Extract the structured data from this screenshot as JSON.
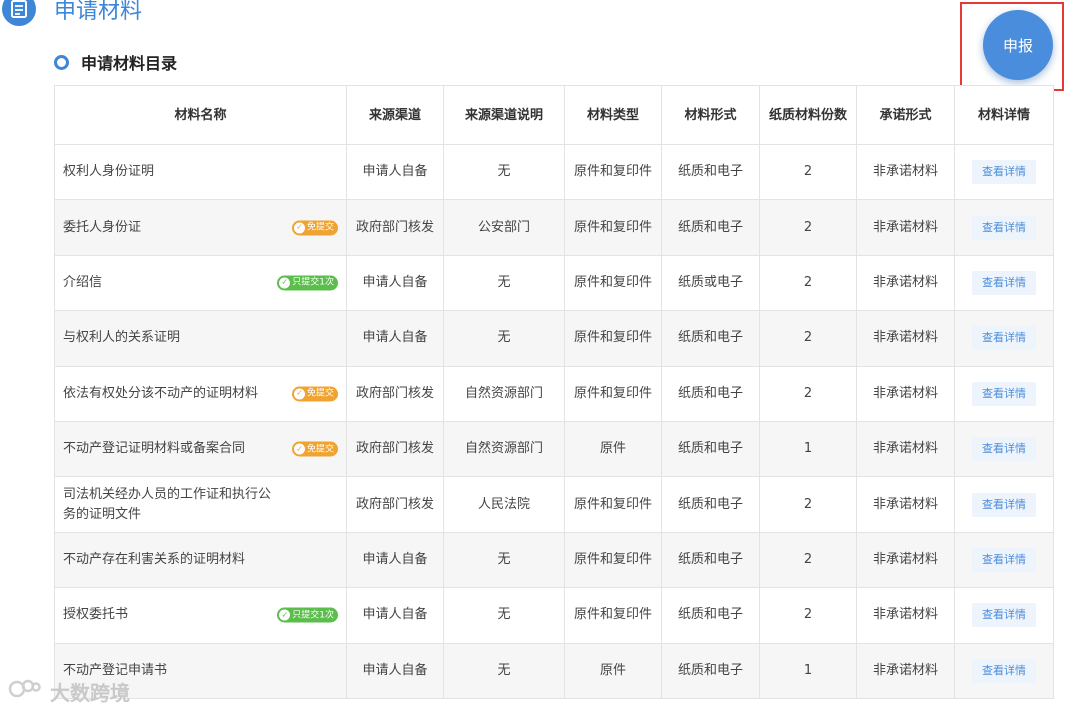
{
  "header": {
    "title": "申请材料",
    "icon": "document-icon"
  },
  "subsection": {
    "title": "申请材料目录",
    "icon": "ring-icon"
  },
  "apply_button": {
    "label": "申报"
  },
  "table": {
    "columns": [
      "材料名称",
      "来源渠道",
      "来源渠道说明",
      "材料类型",
      "材料形式",
      "纸质材料份数",
      "承诺形式",
      "材料详情"
    ],
    "rows": [
      {
        "name": "权利人身份证明",
        "tag": "",
        "tag_color": "",
        "source": "申请人自备",
        "source_note": "无",
        "type": "原件和复印件",
        "form": "纸质和电子",
        "copies": "2",
        "promise": "非承诺材料",
        "detail": "查看详情"
      },
      {
        "name": "委托人身份证",
        "tag": "免提交",
        "tag_color": "orange",
        "source": "政府部门核发",
        "source_note": "公安部门",
        "type": "原件和复印件",
        "form": "纸质和电子",
        "copies": "2",
        "promise": "非承诺材料",
        "detail": "查看详情"
      },
      {
        "name": "介绍信",
        "tag": "只提交1次",
        "tag_color": "green",
        "source": "申请人自备",
        "source_note": "无",
        "type": "原件和复印件",
        "form": "纸质或电子",
        "copies": "2",
        "promise": "非承诺材料",
        "detail": "查看详情"
      },
      {
        "name": "与权利人的关系证明",
        "tag": "",
        "tag_color": "",
        "source": "申请人自备",
        "source_note": "无",
        "type": "原件和复印件",
        "form": "纸质和电子",
        "copies": "2",
        "promise": "非承诺材料",
        "detail": "查看详情"
      },
      {
        "name": "依法有权处分该不动产的证明材料",
        "tag": "免提交",
        "tag_color": "orange",
        "source": "政府部门核发",
        "source_note": "自然资源部门",
        "type": "原件和复印件",
        "form": "纸质和电子",
        "copies": "2",
        "promise": "非承诺材料",
        "detail": "查看详情"
      },
      {
        "name": "不动产登记证明材料或备案合同",
        "tag": "免提交",
        "tag_color": "orange",
        "source": "政府部门核发",
        "source_note": "自然资源部门",
        "type": "原件",
        "form": "纸质和电子",
        "copies": "1",
        "promise": "非承诺材料",
        "detail": "查看详情"
      },
      {
        "name": "司法机关经办人员的工作证和执行公务的证明文件",
        "tag": "",
        "tag_color": "",
        "source": "政府部门核发",
        "source_note": "人民法院",
        "type": "原件和复印件",
        "form": "纸质和电子",
        "copies": "2",
        "promise": "非承诺材料",
        "detail": "查看详情"
      },
      {
        "name": "不动产存在利害关系的证明材料",
        "tag": "",
        "tag_color": "",
        "source": "申请人自备",
        "source_note": "无",
        "type": "原件和复印件",
        "form": "纸质和电子",
        "copies": "2",
        "promise": "非承诺材料",
        "detail": "查看详情"
      },
      {
        "name": "授权委托书",
        "tag": "只提交1次",
        "tag_color": "green",
        "source": "申请人自备",
        "source_note": "无",
        "type": "原件和复印件",
        "form": "纸质和电子",
        "copies": "2",
        "promise": "非承诺材料",
        "detail": "查看详情"
      },
      {
        "name": "不动产登记申请书",
        "tag": "",
        "tag_color": "",
        "source": "申请人自备",
        "source_note": "无",
        "type": "原件",
        "form": "纸质和电子",
        "copies": "1",
        "promise": "非承诺材料",
        "detail": "查看详情"
      }
    ]
  },
  "watermark": {
    "text": "大数跨境",
    "icon": "watermark-logo-icon"
  }
}
